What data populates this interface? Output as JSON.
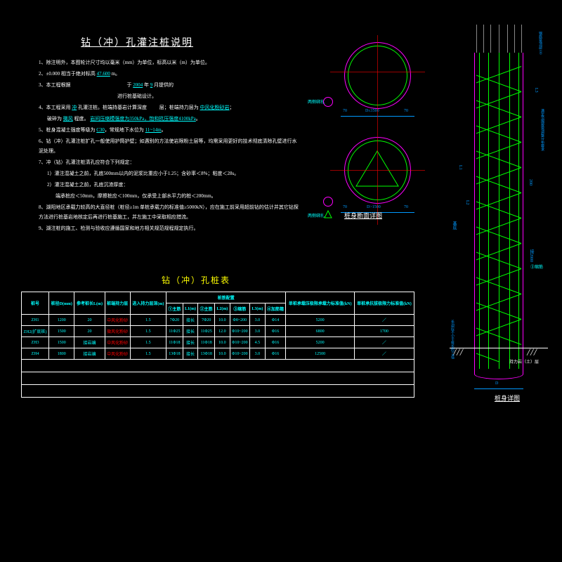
{
  "title": "钻（冲）孔灌注桩说明",
  "notes": {
    "n1": "1、除注明外，本图轮计尺寸均以毫米（mm）为单位，标高以米（m）为单位。",
    "n2a": "2、±0.000 相当于绝对标高",
    "n2b": "47.600",
    "n2c": "m。",
    "n3a": "3、本工程根据",
    "n3b": "于",
    "n3c": "2004",
    "n3d": "年",
    "n3e": "9",
    "n3f": "月提供的",
    "n3g": "进行桩基础设计。",
    "n4a": "4、本工程采用",
    "n4b": "冲",
    "n4c": "孔灌注桩。桩端持基岩计算深度",
    "n4d": "层；桩端持力层为",
    "n4e": "中风化粉砂岩",
    "n4f": "；",
    "n4g": "破碎为",
    "n4h": "微风",
    "n4i": "程度。",
    "n4j": "岩间压缩模强度为350kPa，饱和抗压强度4100kPa",
    "n4k": "。",
    "n5a": "5、桩身混凝土强度等级为",
    "n5b": "C30",
    "n5c": "，常规地下水位为",
    "n5d": "11~14m",
    "n5e": "。",
    "n6": "6、钻（冲）孔灌注桩扩孔一般使用护筒护壁；如遇别的方法使岩限粉土层等，均需采用更好的技术彻底清除孔壁进行水泥处理。",
    "n7": "7、冲（钻）孔灌注桩清孔应符合下列规定：",
    "n7_1": "1）灌注混凝土之前，孔底500mm以内的泥浆比重应小于1.25；含砂率＜8%；粘度＜28s。",
    "n7_2": "2）灌注混凝土之前，孔底沉渣厚度：",
    "n7_3": "端承桩应＜50mm，摩擦桩应＜100mm，仅承受上部水平力的桩＜200mm。",
    "n8": "8、湖阳地区承载力较高的大直径桩（桩径≥1m 单桩承载力的标准值≥5000kN），应在施工前采用超前钻的估计并其它钻探方法进行桩基岩地核定后再进行桩基施工，并左施工中采取相应措流。",
    "n9": "9、湖注桩的施工、检测与验收应遵循国家和地方相关规范规程规定执行。"
  },
  "table_title": "钻（冲）孔桩表",
  "table": {
    "headers": [
      "桩号",
      "桩径D(mm)",
      "参考桩长L(m)",
      "桩端持力层",
      "进入持力层深(m)",
      "桩筋配置",
      "单桩承载压极限承载力标准值(kN)",
      "单桩承抗拔极限力标准值(kN)"
    ],
    "sub_headers": [
      "①主筋",
      "L1(m)",
      "②主筋",
      "L2(m)",
      "③缩筋",
      "L3(m)",
      "④加筋箍"
    ],
    "rows": [
      {
        "id": "ZH1",
        "d": "1200",
        "l": "20",
        "layer": "中风化粉砂",
        "depth": "1.5",
        "r1": "7Φ20",
        "l1": "接长",
        "r2": "7Φ20",
        "l2": "10.0",
        "r3": "Φ8~200",
        "l3": "3.0",
        "r4": "Φ14",
        "cap1": "5200",
        "cap2": "／"
      },
      {
        "id": "ZH2(扩底桩)",
        "d": "1500",
        "l": "20",
        "layer": "微风化粉砂",
        "depth": "1.5",
        "r1": "11Φ25",
        "l1": "接长",
        "r2": "11Φ25",
        "l2": "12.0",
        "r3": "Φ10~200",
        "l3": "3.0",
        "r4": "Φ16",
        "cap1": "6800",
        "cap2": "1700"
      },
      {
        "id": "ZH3",
        "d": "1500",
        "l": "接岩编",
        "layer": "中风化粉砂",
        "depth": "1.5",
        "r1": "11Φ18",
        "l1": "接长",
        "r2": "11Φ18",
        "l2": "10.0",
        "r3": "Φ10~200",
        "l3": "4.5",
        "r4": "Φ16",
        "cap1": "5200",
        "cap2": "／"
      },
      {
        "id": "ZH4",
        "d": "1800",
        "l": "接岩编",
        "layer": "中风化粉砂",
        "depth": "1.5",
        "r1": "13Φ18",
        "l1": "接长",
        "r2": "13Φ18",
        "l2": "10.0",
        "r3": "Φ10~200",
        "l3": "3.0",
        "r4": "Φ16",
        "cap1": "12500",
        "cap2": "／"
      }
    ]
  },
  "section": {
    "label": "桩身断面详图",
    "dim1": "70",
    "dim2": "D≤1500",
    "dim3": "70",
    "dim4": "D>1500",
    "note1": "两侧绑扎",
    "note2": "两侧绑扎"
  },
  "pile": {
    "label": "桩身详图",
    "ground": "持力岩（土）层",
    "top_note": "钢筋笼顶部100",
    "side_note": "满足范围按需调整分布要求",
    "d_label": "D",
    "l1": "L1",
    "l2": "L2",
    "l3": "L3",
    "dim1": "200",
    "dim2": "接2000",
    "dim3": "③缩筋",
    "dim4": "基底",
    "dim5": "长边应不小于桩长的0.6倍"
  }
}
